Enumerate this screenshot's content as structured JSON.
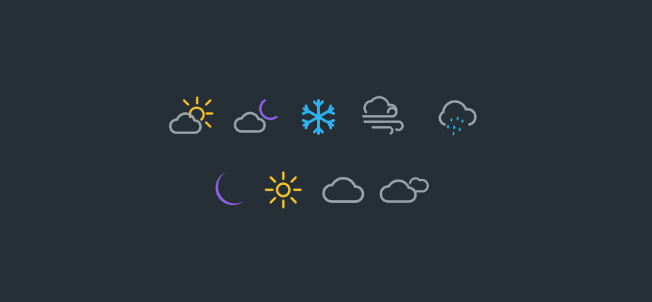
{
  "colors": {
    "background": "#262e36",
    "cloud": "#9aa4ab",
    "sun": "#f7c52b",
    "moon": "#8e63e6",
    "snow": "#2ab3f0",
    "rain": "#2ab3f0"
  },
  "icons": {
    "row1": [
      "partly-cloudy-day-icon",
      "partly-cloudy-night-icon",
      "snowflake-icon",
      "wind-icon",
      "rain-icon"
    ],
    "row2": [
      "moon-icon",
      "sun-icon",
      "cloud-icon",
      "overcast-icon"
    ]
  }
}
